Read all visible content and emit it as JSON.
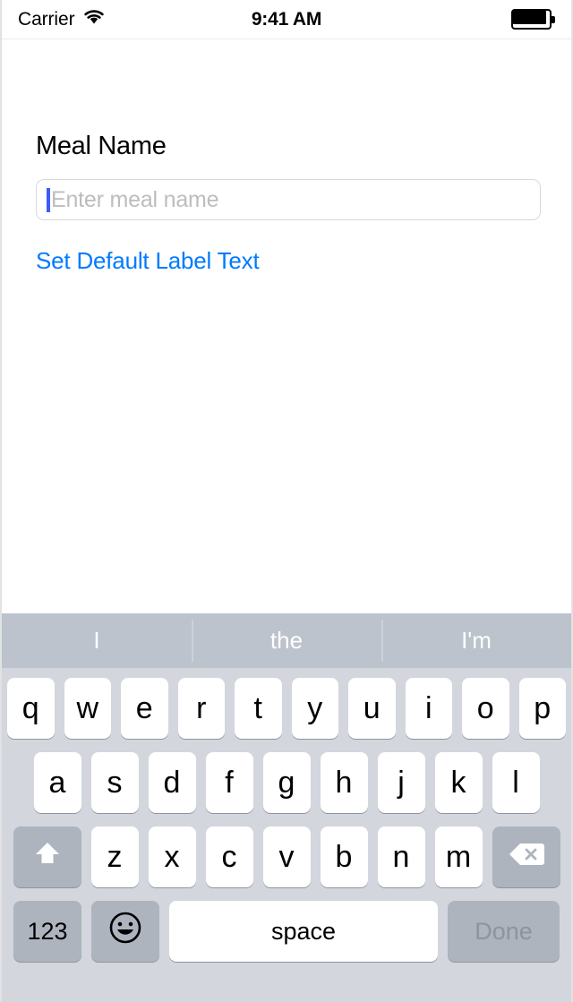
{
  "status_bar": {
    "carrier": "Carrier",
    "wifi_icon": "wifi-icon",
    "time": "9:41 AM",
    "battery_icon": "battery-full-icon"
  },
  "form": {
    "field_label": "Meal Name",
    "input_placeholder": "Enter meal name",
    "input_value": "",
    "link_label": "Set Default Label Text",
    "link_color": "#007AFF"
  },
  "keyboard": {
    "predictions": [
      "I",
      "the",
      "I'm"
    ],
    "row1": [
      "q",
      "w",
      "e",
      "r",
      "t",
      "y",
      "u",
      "i",
      "o",
      "p"
    ],
    "row2": [
      "a",
      "s",
      "d",
      "f",
      "g",
      "h",
      "j",
      "k",
      "l"
    ],
    "row3": [
      "z",
      "x",
      "c",
      "v",
      "b",
      "n",
      "m"
    ],
    "shift_icon": "shift-arrow-icon",
    "delete_icon": "backspace-icon",
    "numbers_key": "123",
    "emoji_icon": "emoji-smiley-icon",
    "space_key": "space",
    "done_key": "Done",
    "done_enabled": false
  }
}
